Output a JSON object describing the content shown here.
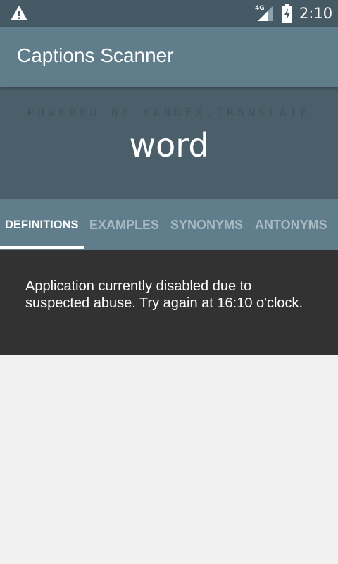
{
  "status_bar": {
    "network": "4G",
    "time": "2:10",
    "icons": [
      "warning-icon",
      "signal-icon",
      "battery-charging-icon"
    ]
  },
  "app_bar": {
    "title": "Captions Scanner"
  },
  "header": {
    "powered_by": "POWERED BY YANDEX.TRANSLATE",
    "word": "word"
  },
  "tabs": [
    {
      "label": "DEFINITIONS",
      "active": true
    },
    {
      "label": "EXAMPLES",
      "active": false
    },
    {
      "label": "SYNONYMS",
      "active": false
    },
    {
      "label": "ANTONYMS",
      "active": false
    }
  ],
  "message": {
    "text": "Application currently disabled due to suspected abuse. Try again at 16:10 o'clock."
  },
  "colors": {
    "status_bar": "#455a64",
    "primary": "#607d8b",
    "header_panel": "#4a5f6a",
    "snackbar": "#323232",
    "background": "#f1f1f1"
  }
}
